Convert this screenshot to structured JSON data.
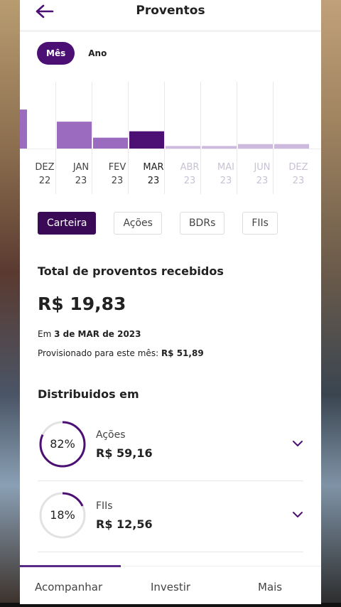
{
  "header": {
    "title": "Proventos"
  },
  "period_toggle": {
    "options": [
      "Mês",
      "Ano"
    ],
    "selected": "Mês"
  },
  "chart_data": {
    "type": "bar",
    "categories": [
      "DEZ 22",
      "JAN 23",
      "FEV 23",
      "MAR 23",
      "ABR 23",
      "MAI 23",
      "JUN 23",
      "DEZ 23"
    ],
    "months": [
      "DEZ",
      "JAN",
      "FEV",
      "MAR",
      "ABR",
      "MAI",
      "JUN",
      "DEZ"
    ],
    "years": [
      "22",
      "23",
      "23",
      "23",
      "23",
      "23",
      "23",
      "23"
    ],
    "values": [
      61,
      42,
      17,
      27,
      4,
      4,
      7,
      7
    ],
    "selected_index": 3,
    "future_from_index": 4,
    "ylim": [
      0,
      100
    ],
    "title": "",
    "xlabel": "",
    "ylabel": ""
  },
  "filters": [
    "Carteira",
    "Ações",
    "BDRs",
    "FIIs"
  ],
  "summary": {
    "total_label": "Total de proventos recebidos",
    "total_value": "R$ 19,83",
    "date_prefix": "Em",
    "date_value": "3 de MAR de 2023",
    "provisioned_label": "Provisionado para este mês:",
    "provisioned_value": "R$ 51,89"
  },
  "distribution": {
    "title": "Distribuidos em",
    "items": [
      {
        "name": "Ações",
        "value": "R$ 59,16",
        "percent_label": "82%",
        "percent": 82
      },
      {
        "name": "FIIs",
        "value": "R$ 12,56",
        "percent_label": "18%",
        "percent": 18
      }
    ]
  },
  "bottom_nav": {
    "items": [
      "Acompanhar",
      "Investir",
      "Mais"
    ],
    "active": "Acompanhar"
  },
  "colors": {
    "primary": "#4c0f73",
    "bar_past": "#9b6bbf",
    "bar_selected": "#4c0f73",
    "bar_future": "#cdb8de",
    "ring_track": "#e2e2e2"
  },
  "icons": {
    "back": "arrow-left-icon",
    "chevron": "chevron-down-icon"
  }
}
